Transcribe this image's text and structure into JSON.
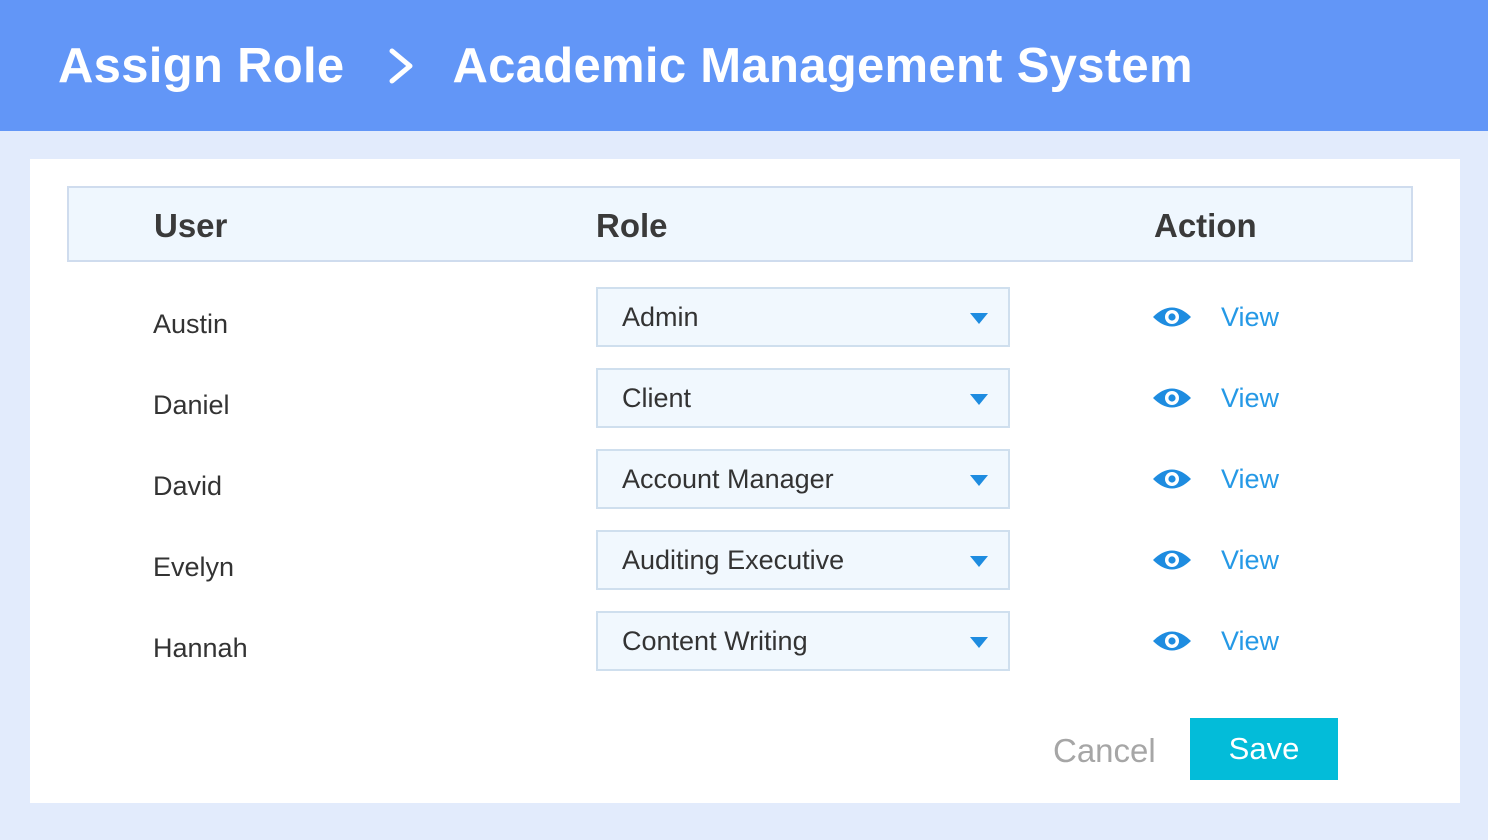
{
  "header": {
    "crumb_parent": "Assign Role",
    "crumb_current": "Academic Management System"
  },
  "table": {
    "columns": {
      "user": "User",
      "role": "Role",
      "action": "Action"
    },
    "rows": [
      {
        "user": "Austin",
        "role": "Admin",
        "action": "View"
      },
      {
        "user": "Daniel",
        "role": "Client",
        "action": "View"
      },
      {
        "user": "David",
        "role": "Account Manager",
        "action": "View"
      },
      {
        "user": "Evelyn",
        "role": "Auditing Executive",
        "action": "View"
      },
      {
        "user": "Hannah",
        "role": "Content Writing",
        "action": "View"
      }
    ]
  },
  "footer": {
    "cancel_label": "Cancel",
    "save_label": "Save"
  },
  "icons": {
    "breadcrumb_separator": "chevron-right-icon",
    "row_action": "eye-icon",
    "select_toggle": "caret-down-icon"
  },
  "colors": {
    "header_bg": "#6296f7",
    "page_bg": "#e2ebfc",
    "link": "#2599e6",
    "save_button": "#03bcd9"
  }
}
